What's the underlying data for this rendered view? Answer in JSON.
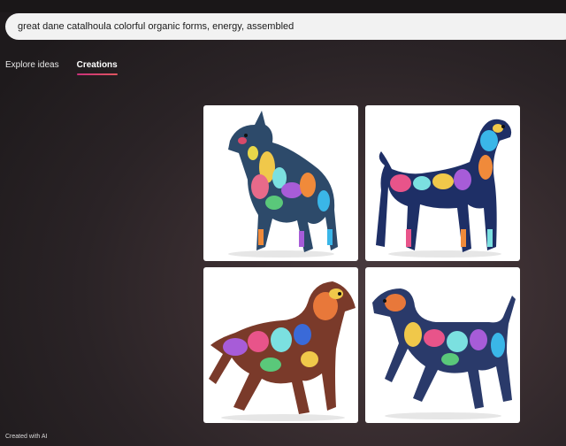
{
  "search": {
    "query": "great dane catalhoula colorful organic forms, energy, assembled"
  },
  "tabs": [
    {
      "label": "Explore ideas",
      "active": false
    },
    {
      "label": "Creations",
      "active": true
    }
  ],
  "images": [
    {
      "subject": "standing-dog-facing-left-icon"
    },
    {
      "subject": "standing-dog-facing-right-icon"
    },
    {
      "subject": "walking-dog-facing-right-icon"
    },
    {
      "subject": "walking-dog-facing-left-icon"
    }
  ],
  "footer": {
    "label": "Created with AI"
  },
  "colors": {
    "accent_gradient_start": "#c9307a",
    "accent_gradient_end": "#e0565f",
    "search_bg": "#f2f2f2"
  }
}
